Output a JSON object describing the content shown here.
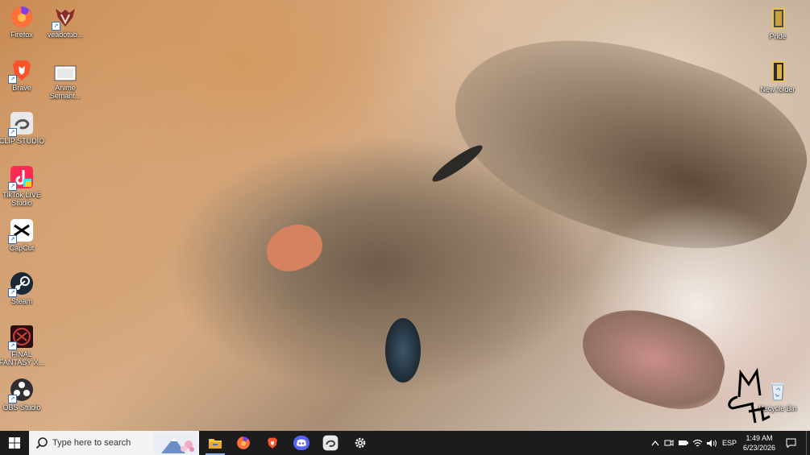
{
  "desktop": {
    "icons_left": [
      {
        "label": "Firefox"
      },
      {
        "label": "veadotub..."
      },
      {
        "label": "Brave"
      },
      {
        "label": "Anime Semant..."
      },
      {
        "label": "CLIP STUDIO"
      },
      {
        "label": "TikTok LIVE Studio"
      },
      {
        "label": "CapCut"
      },
      {
        "label": "Steam"
      },
      {
        "label": "FINAL FANTASY X..."
      },
      {
        "label": "OBS Studio"
      }
    ],
    "icons_right": [
      {
        "label": "Pride"
      },
      {
        "label": "New folder"
      },
      {
        "label": "Recycle Bin"
      }
    ]
  },
  "taskbar": {
    "search_placeholder": "Type here to search",
    "apps": [
      "file-explorer",
      "firefox",
      "brave",
      "discord",
      "clip-studio",
      "settings"
    ],
    "tray": {
      "language": "ESP",
      "time": "1:49 AM",
      "date": "6/23/2026"
    }
  },
  "colors": {
    "taskbar_bg": "#1c1c1c",
    "search_bg": "#f3f3f3",
    "active_indicator": "#8fb4e6"
  }
}
